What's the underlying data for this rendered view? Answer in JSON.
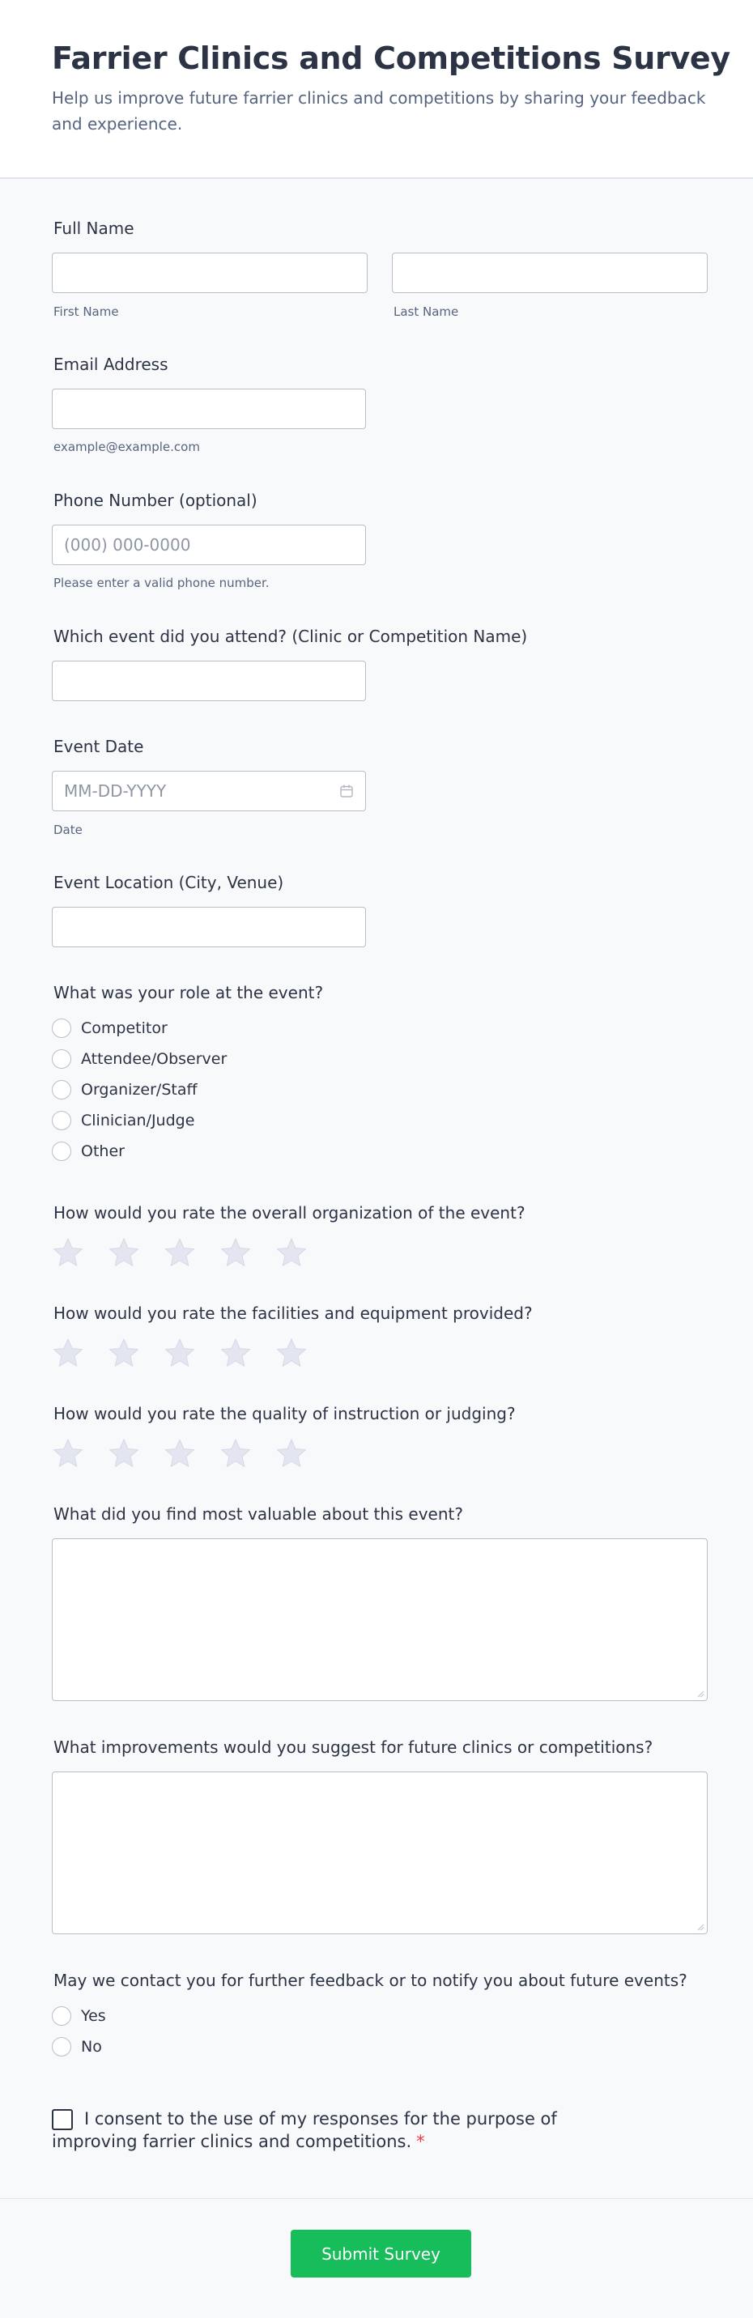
{
  "header": {
    "title": "Farrier Clinics and Competitions Survey",
    "subtitle": "Help us improve future farrier clinics and competitions by sharing your feedback and experience."
  },
  "full_name": {
    "label": "Full Name",
    "first_sublabel": "First Name",
    "last_sublabel": "Last Name"
  },
  "email": {
    "label": "Email Address",
    "sublabel": "example@example.com"
  },
  "phone": {
    "label": "Phone Number (optional)",
    "placeholder": "(000) 000-0000",
    "sublabel": "Please enter a valid phone number."
  },
  "event_name": {
    "label": "Which event did you attend? (Clinic or Competition Name)"
  },
  "event_date": {
    "label": "Event Date",
    "placeholder": "MM-DD-YYYY",
    "sublabel": "Date",
    "icon": "calendar-icon"
  },
  "event_location": {
    "label": "Event Location (City, Venue)"
  },
  "role": {
    "label": "What was your role at the event?",
    "options": [
      "Competitor",
      "Attendee/Observer",
      "Organizer/Staff",
      "Clinician/Judge",
      "Other"
    ]
  },
  "ratings": [
    {
      "label": "How would you rate the overall organization of the event?",
      "stars": 5,
      "value": 0
    },
    {
      "label": "How would you rate the facilities and equipment provided?",
      "stars": 5,
      "value": 0
    },
    {
      "label": "How would you rate the quality of instruction or judging?",
      "stars": 5,
      "value": 0
    }
  ],
  "valuable": {
    "label": "What did you find most valuable about this event?"
  },
  "improvements": {
    "label": "What improvements would you suggest for future clinics or competitions?"
  },
  "contact": {
    "label": "May we contact you for further feedback or to notify you about future events?",
    "options": [
      "Yes",
      "No"
    ]
  },
  "consent": {
    "text": "I consent to the use of my responses for the purpose of improving farrier clinics and competitions.",
    "required_mark": "*"
  },
  "submit": {
    "label": "Submit Survey"
  },
  "colors": {
    "accent": "#18bd5b",
    "star": "#e3e5f0",
    "required": "#f23a3c",
    "text": "#2c3345"
  }
}
